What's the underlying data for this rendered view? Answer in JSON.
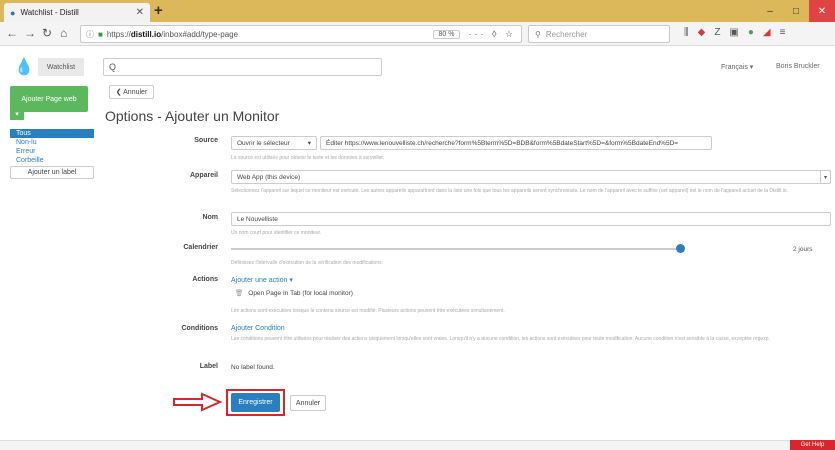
{
  "browser": {
    "tab_title": "Watchlist - Distill",
    "url_prefix": "https://",
    "url_domain": "distill.io",
    "url_path": "/inbox#add/type-page",
    "zoom": "80 %",
    "search_placeholder": "Rechercher",
    "icons": [
      "library-icon",
      "pocket-icon",
      "zotero-icon",
      "reader-icon",
      "extension-icon",
      "distill-icon",
      "menu-icon"
    ]
  },
  "header": {
    "watchlist_label": "Watchlist",
    "search_value": "Q",
    "language": "Français ▾",
    "user": "Boris Bruckler"
  },
  "sidebar": {
    "add_button": "Ajouter Page web",
    "plus": "▾",
    "items": [
      {
        "label": "Tous",
        "active": true
      },
      {
        "label": "Non-lu",
        "active": false
      },
      {
        "label": "Erreur",
        "active": false
      },
      {
        "label": "Corbeille",
        "active": false
      }
    ],
    "add_label_button": "Ajouter un label"
  },
  "main": {
    "cancel_top": "❮ Annuler",
    "title": "Options - Ajouter un Monitor",
    "source": {
      "label": "Source",
      "selector_button": "Ouvrir le sélecteur",
      "url_value": "Éditer https://www.lenouvelliste.ch/recherche?form%5Bterm%5D=BDB&form%5BdateStart%5D=&form%5BdateEnd%5D=",
      "help": "La source est utilisée pour obtenir le texte et les données à surveiller."
    },
    "device": {
      "label": "Appareil",
      "value": "Web App (this device)",
      "help": "Sélectionnez l'appareil sur lequel ce moniteur est exécuté. Les autres appareils apparaîtront dans la liste une fois que tous les appareils seront synchronisés. Le nom de l'appareil avec le suffixe (cet appareil) est le nom de l'appareil actuel de la Distill.io."
    },
    "name": {
      "label": "Nom",
      "value": "Le Nouvelliste",
      "help": "Un nom court pour identifier ce moniteur."
    },
    "schedule": {
      "label": "Calendrier",
      "value": "2 jours",
      "position": 0.985,
      "help": "Définissez l'intervalle d'exécution de la vérification des modifications."
    },
    "actions": {
      "label": "Actions",
      "add_link": "Ajouter une action ▾",
      "item": "Open Page In Tab (for local monitor)",
      "help": "Les actions sont exécutées lorsque le contenu source est modifié. Plusieurs actions peuvent être exécutées simultanément."
    },
    "conditions": {
      "label": "Conditions",
      "add_link": "Ajouter Condition",
      "help": "Les conditions peuvent être utilisées pour réaliser des actions uniquement lorsqu'elles sont vraies. Lorsqu'il n'y a aucune condition, les actions sont exécutées pour toute modification. Aucune condition n'est sensible à la casse, exceptée regexp."
    },
    "label_field": {
      "label": "Label",
      "value": "No label found."
    },
    "save_button": "Enregistrer",
    "cancel_button": "Annuler"
  },
  "footer": {
    "chat": "Get Help"
  },
  "colors": {
    "titlebar": "#dcb85a",
    "primary": "#2a7fc0",
    "green": "#5cb85c",
    "highlight": "#d9262c"
  }
}
